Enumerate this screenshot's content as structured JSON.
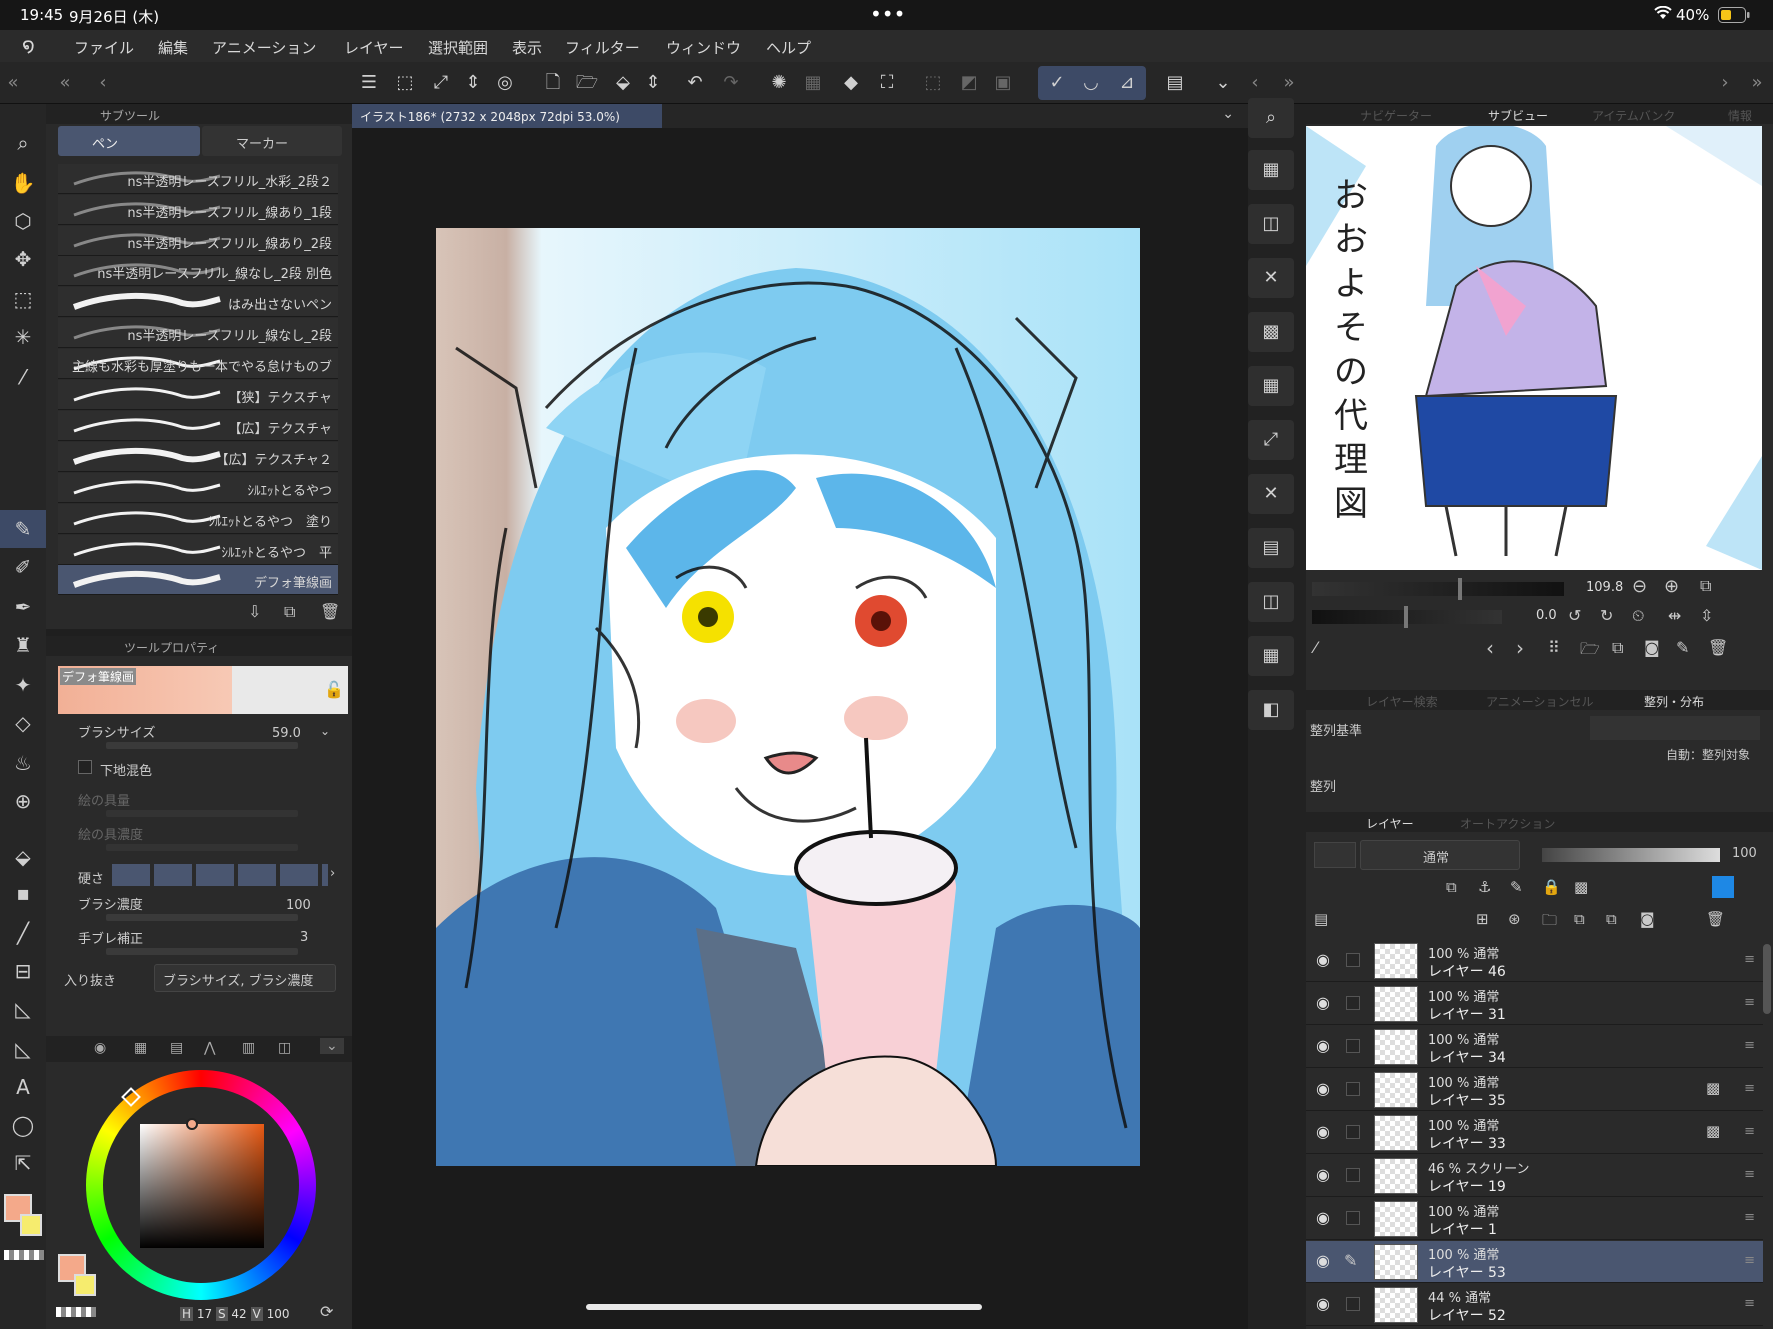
{
  "status": {
    "time": "19:45",
    "date": "9月26日 (木)",
    "dots": "•••",
    "wifi_icon": "wifi-icon",
    "battery": "40%",
    "battery_color": "#f5c518"
  },
  "menu": {
    "items": [
      "ファイル",
      "編集",
      "アニメーション",
      "レイヤー",
      "選択範囲",
      "表示",
      "フィルター",
      "ウィンドウ",
      "ヘルプ"
    ]
  },
  "document": {
    "tab": "イラスト186* (2732 x 2048px 72dpi 53.0%)"
  },
  "subtool": {
    "panel_title": "サブツール",
    "tabs": [
      "ペン",
      "マーカー"
    ],
    "brushes": [
      "ns半透明レースフリル_水彩_2段２",
      "ns半透明レースフリル_線あり_1段",
      "ns半透明レースフリル_線あり_2段",
      "ns半透明レースフリル_線なし_2段 別色",
      "はみ出さないペン",
      "ns半透明レースフリル_線なし_2段",
      "主線も水彩も厚塗りも一本でやる怠けものブ",
      "【狭】テクスチャ",
      "【広】テクスチャ",
      "【広】テクスチャ２",
      "ｼﾙｴｯﾄとるやつ",
      "ｼﾙｴｯﾄとるやつ　塗り",
      "ｼﾙｴｯﾄとるやつ　平",
      "デフォ筆線画"
    ]
  },
  "toolprop": {
    "panel_title": "ツールプロパティ",
    "preview_name": "デフォ筆線画",
    "brush_size_label": "ブラシサイズ",
    "brush_size": "59.0",
    "underlay_label": "下地混色",
    "paint_amount": "絵の具量",
    "paint_density": "絵の具濃度",
    "hardness_label": "硬さ",
    "brush_density_label": "ブラシ濃度",
    "brush_density": "100",
    "stabilizer_label": "手ブレ補正",
    "stabilizer": "3",
    "taper_label": "入り抜き",
    "taper_value": "ブラシサイズ, ブラシ濃度"
  },
  "color": {
    "main": "#f4a98a",
    "sub": "#f6ec6e",
    "h": "17",
    "s": "42",
    "v": "100",
    "h_label": "H",
    "s_label": "S",
    "v_label": "V"
  },
  "navigator": {
    "tabs": [
      "ナビゲーター",
      "サブビュー",
      "アイテムバンク",
      "情報"
    ],
    "zoom": "109.8",
    "rotate": "0.0"
  },
  "align": {
    "tabs": [
      "レイヤー検索",
      "アニメーションセル",
      "整列・分布"
    ],
    "basis_label": "整列基準",
    "auto_label": "自動：整列対象",
    "align_label": "整列"
  },
  "layers_panel": {
    "tabs": [
      "レイヤー",
      "オートアクション"
    ],
    "blend_mode": "通常",
    "opacity": "100",
    "layers": [
      {
        "meta": "100 %  通常",
        "name": "レイヤー 46"
      },
      {
        "meta": "100 %  通常",
        "name": "レイヤー 31"
      },
      {
        "meta": "100 %  通常",
        "name": "レイヤー 34"
      },
      {
        "meta": "100 %  通常",
        "name": "レイヤー 35"
      },
      {
        "meta": "100 %  通常",
        "name": "レイヤー 33"
      },
      {
        "meta": "46 %  スクリーン",
        "name": "レイヤー 19"
      },
      {
        "meta": "100 %  通常",
        "name": "レイヤー 1"
      },
      {
        "meta": "100 %  通常",
        "name": "レイヤー 53"
      },
      {
        "meta": "44 %  通常",
        "name": "レイヤー 52"
      }
    ]
  },
  "subview_text": "おおよその代理図"
}
